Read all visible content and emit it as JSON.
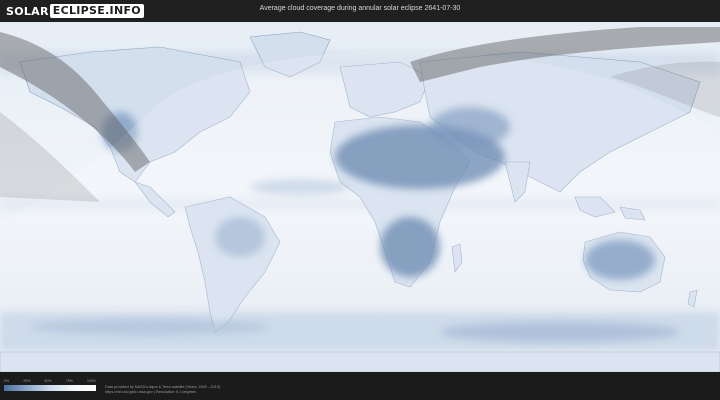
{
  "header": {
    "logo_part1": "SOLAR",
    "logo_part2": "ECLIPSE.INFO",
    "title": "Average cloud coverage during annular solar eclipse 2641-07-30"
  },
  "legend": {
    "ticks": [
      "0%",
      "25%",
      "50%",
      "75%",
      "100%"
    ],
    "colors": [
      "#4a6fa0",
      "#8ea9cd",
      "#cfdbeb",
      "#f4f7fb",
      "#ffffff"
    ]
  },
  "footer": {
    "credit_line1": "Data provided by NASA's Aqua & Terra satellite (Years: 2000 - 2019)",
    "credit_line2": "https://neo.sci.gsfc.nasa.gov | Resolution: 0.1 degrees"
  },
  "map": {
    "colors": {
      "clear": "#4a6fa0",
      "cloudy": "#f4f7fb",
      "eclipse_path": "#5a5a5a",
      "visibility_zone": "#ffffff"
    }
  }
}
